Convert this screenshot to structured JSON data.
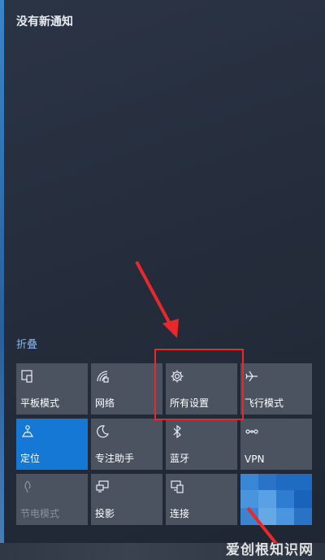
{
  "header": {
    "title": "没有新通知"
  },
  "action_center": {
    "collapse_label": "折叠"
  },
  "tiles": [
    {
      "label": "平板模式",
      "icon": "tablet-mode-icon",
      "state": "off"
    },
    {
      "label": "网络",
      "icon": "network-icon",
      "state": "off"
    },
    {
      "label": "所有设置",
      "icon": "gear-icon",
      "state": "off"
    },
    {
      "label": "飞行模式",
      "icon": "airplane-icon",
      "state": "off"
    },
    {
      "label": "定位",
      "icon": "location-icon",
      "state": "on"
    },
    {
      "label": "专注助手",
      "icon": "moon-icon",
      "state": "off"
    },
    {
      "label": "蓝牙",
      "icon": "bluetooth-icon",
      "state": "off"
    },
    {
      "label": "VPN",
      "icon": "vpn-icon",
      "state": "off"
    },
    {
      "label": "节电模式",
      "icon": "battery-saver-icon",
      "state": "disabled"
    },
    {
      "label": "投影",
      "icon": "project-icon",
      "state": "off"
    },
    {
      "label": "连接",
      "icon": "connect-icon",
      "state": "off"
    }
  ],
  "watermark": {
    "text": "爱创根知识网"
  },
  "colors": {
    "accent": "#1478d4",
    "annotation": "#e8282b",
    "tile": "#4b5361"
  }
}
